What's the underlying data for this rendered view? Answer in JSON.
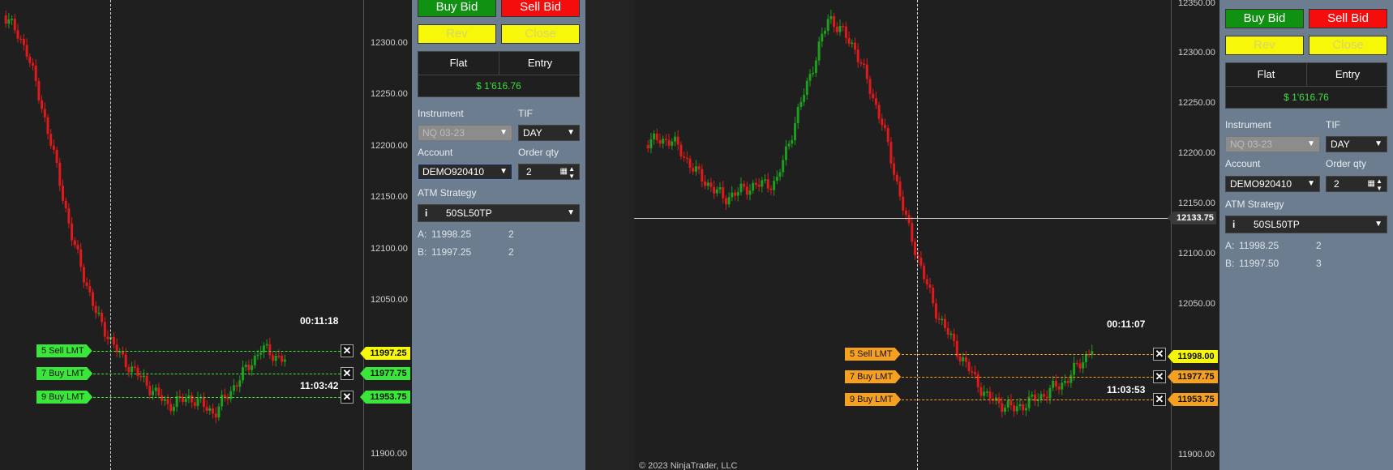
{
  "left": {
    "axis_ticks": [
      "12300.00",
      "12250.00",
      "12200.00",
      "12150.00",
      "12100.00",
      "12050.00",
      "11900.00"
    ],
    "timer_top": "00:11:18",
    "timer_bottom": "11:03:42",
    "orders": [
      {
        "label": "5  Sell LMT",
        "price": "11997.25"
      },
      {
        "label": "7  Buy LMT",
        "price": "11977.75"
      },
      {
        "label": "9  Buy LMT",
        "price": "11953.75"
      }
    ],
    "order_color": "#39e639",
    "ask_price_color": "#f7f70a"
  },
  "left_panel": {
    "buy_bid": "Buy Bid",
    "sell_bid": "Sell Bid",
    "rev": "Rev",
    "close": "Close",
    "position": "Flat",
    "entry": "Entry",
    "pnl": "$ 1'616.76",
    "instrument_label": "Instrument",
    "instrument": "NQ 03-23",
    "tif_label": "TIF",
    "tif": "DAY",
    "account_label": "Account",
    "account": "DEMO920410",
    "qty_label": "Order qty",
    "qty": "2",
    "atm_label": "ATM Strategy",
    "atm": "50SL50TP",
    "ask_label": "A:",
    "ask_price": "11998.25",
    "ask_qty": "2",
    "bid_label": "B:",
    "bid_price": "11997.25",
    "bid_qty": "2"
  },
  "right": {
    "axis_ticks": [
      "12350.00",
      "12300.00",
      "12250.00",
      "12200.00",
      "12150.00",
      "12100.00",
      "12050.00",
      "11900.00"
    ],
    "crosshair_price": "12133.75",
    "timer_top": "00:11:07",
    "timer_bottom": "11:03:53",
    "orders": [
      {
        "label": "5  Sell LMT",
        "price": "11998.00"
      },
      {
        "label": "7  Buy LMT",
        "price": "11977.75"
      },
      {
        "label": "9  Buy LMT",
        "price": "11953.75"
      }
    ],
    "order_color": "#f5a020",
    "copyright": "© 2023 NinjaTrader, LLC"
  },
  "right_panel": {
    "buy_bid": "Buy Bid",
    "sell_bid": "Sell Bid",
    "rev": "Rev",
    "close": "Close",
    "position": "Flat",
    "entry": "Entry",
    "pnl": "$ 1'616.76",
    "instrument_label": "Instrument",
    "instrument": "NQ 03-23",
    "tif_label": "TIF",
    "tif": "DAY",
    "account_label": "Account",
    "account": "DEMO920410",
    "qty_label": "Order qty",
    "qty": "2",
    "atm_label": "ATM Strategy",
    "atm": "50SL50TP",
    "ask_label": "A:",
    "ask_price": "11998.25",
    "ask_qty": "2",
    "bid_label": "B:",
    "bid_price": "11997.50",
    "bid_qty": "3"
  }
}
